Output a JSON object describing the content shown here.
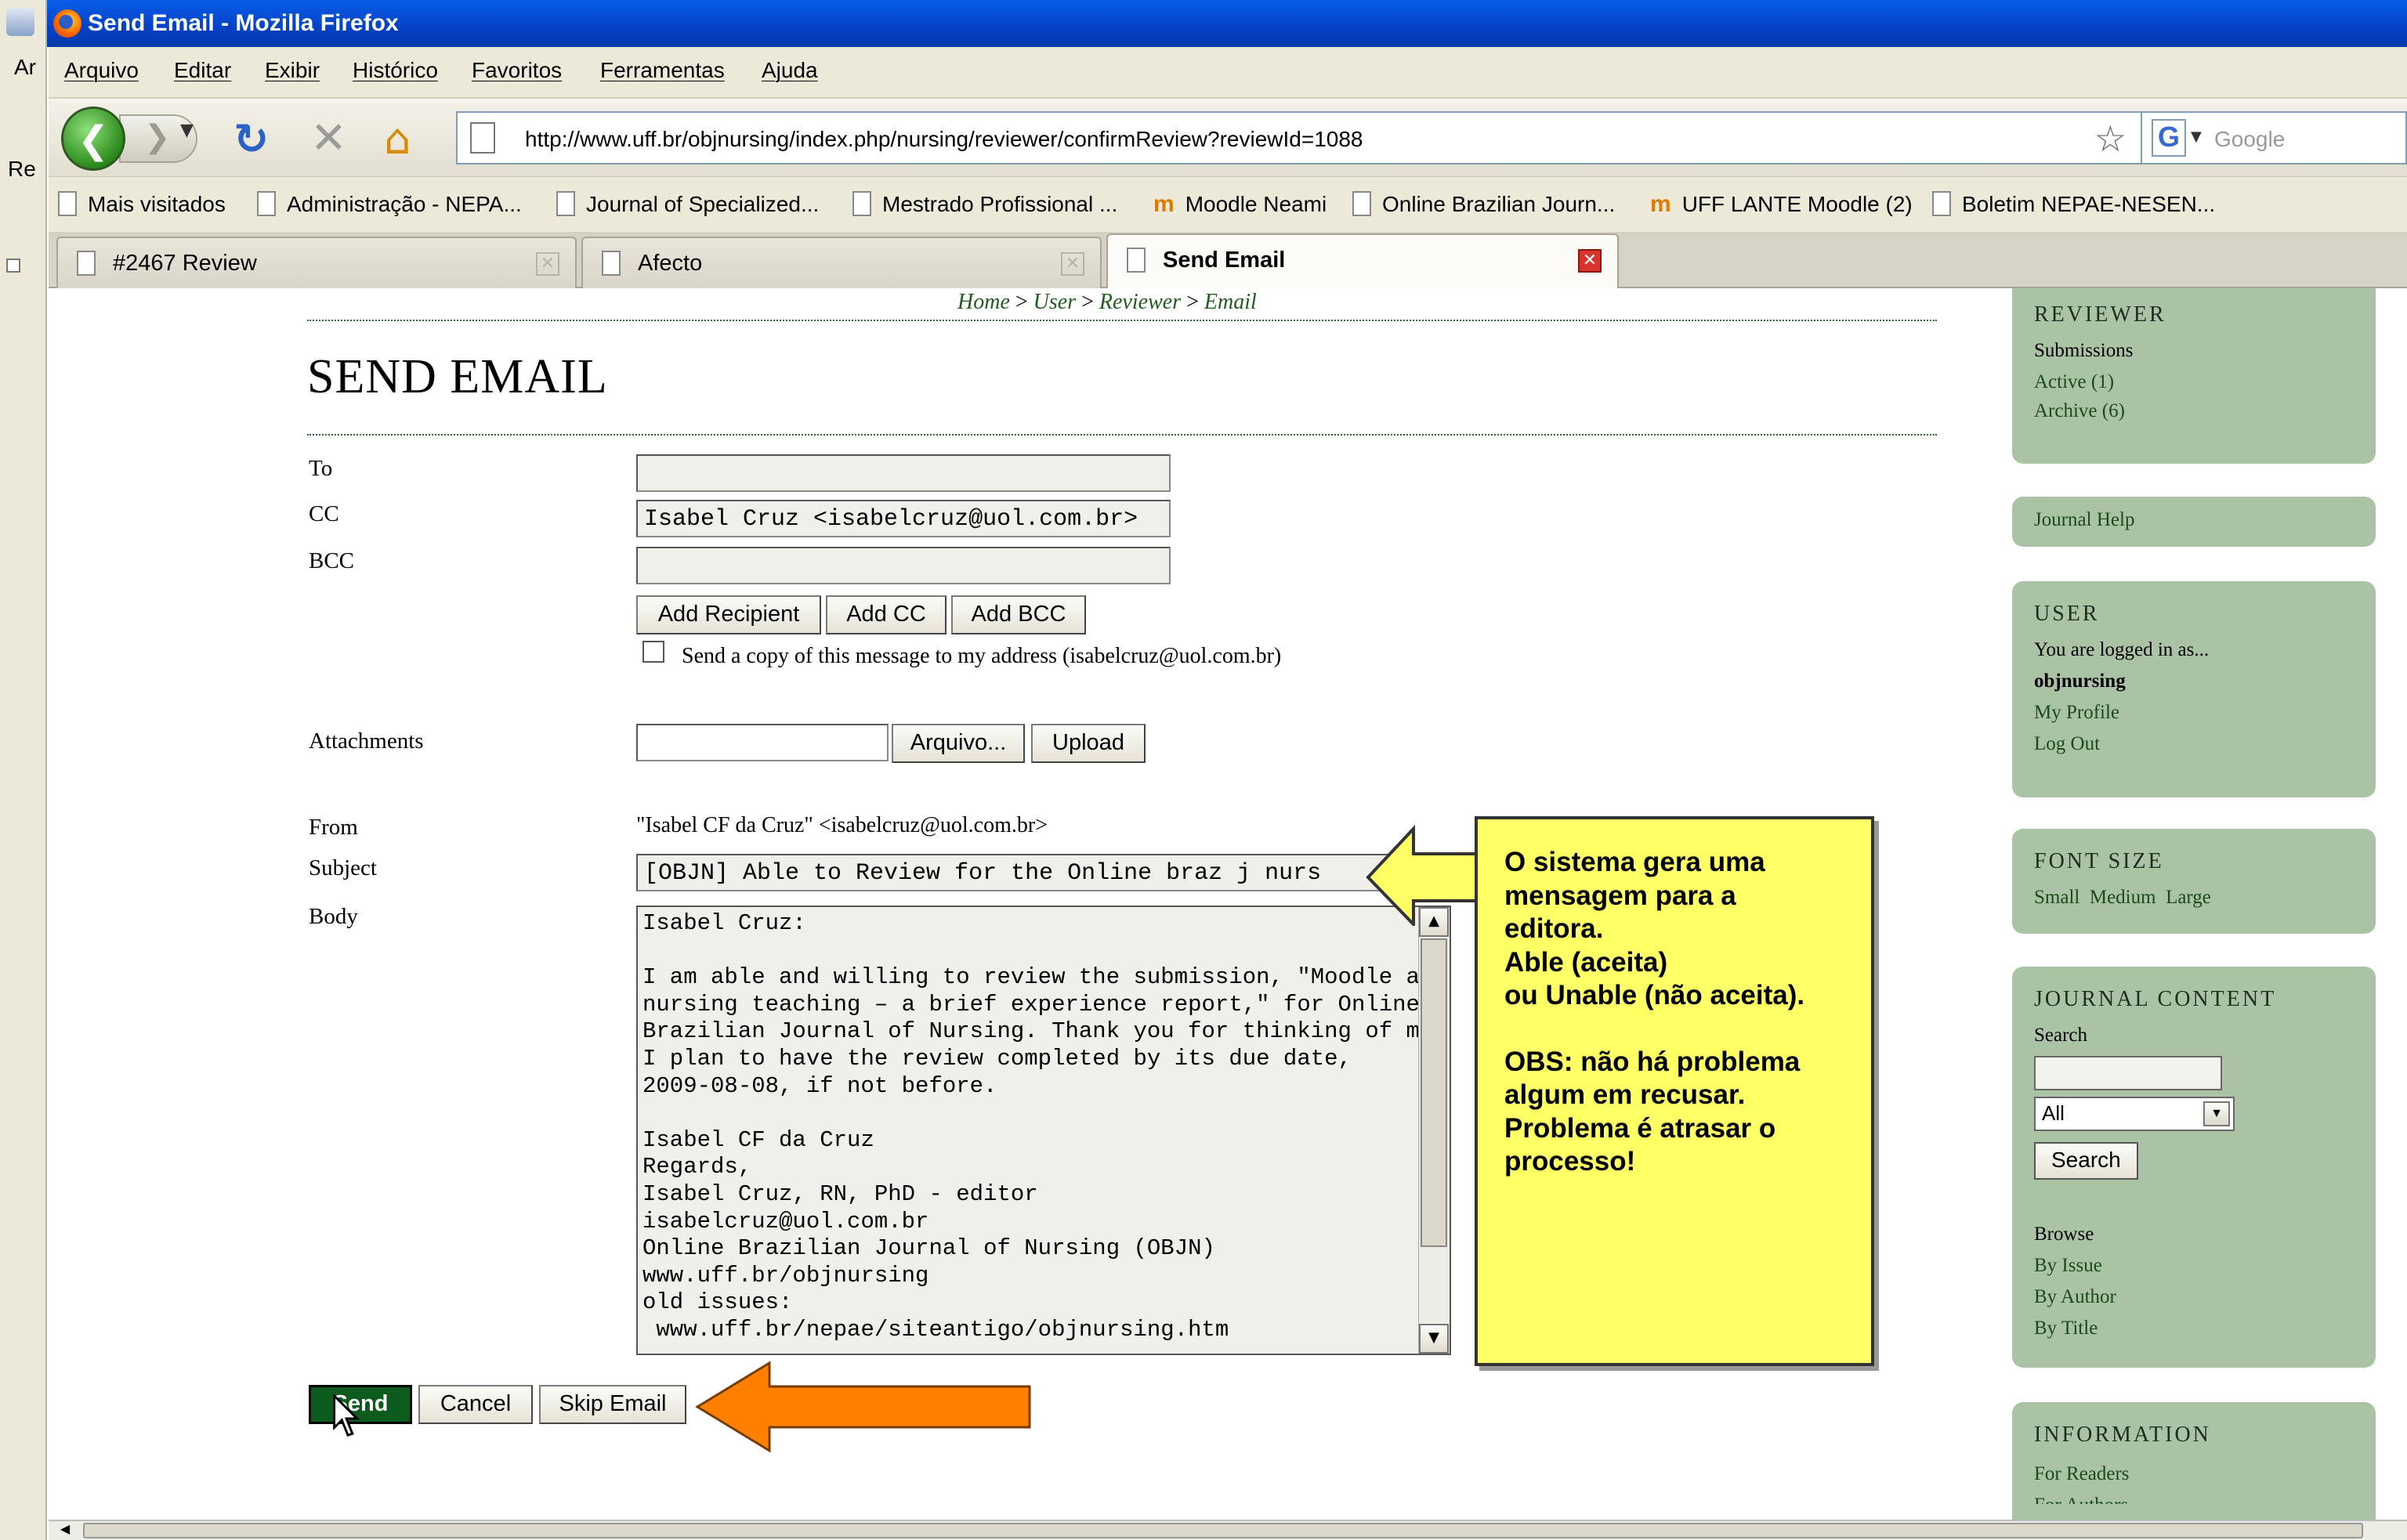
{
  "window": {
    "title": "Send Email - Mozilla Firefox"
  },
  "leftstrip": {
    "frag1": "Ar",
    "frag2": "Re"
  },
  "menu": [
    "Arquivo",
    "Editar",
    "Exibir",
    "Histórico",
    "Favoritos",
    "Ferramentas",
    "Ajuda"
  ],
  "nav": {
    "url": "http://www.uff.br/objnursing/index.php/nursing/reviewer/confirmReview?reviewId=1088",
    "search_placeholder": "Google",
    "search_engine_letter": "G"
  },
  "bookmarks": [
    {
      "label": "Mais visitados",
      "icon": "page-icon"
    },
    {
      "label": "Administração - NEPA...",
      "icon": "page-icon"
    },
    {
      "label": "Journal of Specialized...",
      "icon": "page-icon"
    },
    {
      "label": "Mestrado Profissional ...",
      "icon": "page-icon"
    },
    {
      "label": "Moodle Neami",
      "icon": "moodle-icon"
    },
    {
      "label": "Online Brazilian Journ...",
      "icon": "page-icon"
    },
    {
      "label": "UFF LANTE Moodle (2)",
      "icon": "moodle-icon"
    },
    {
      "label": "Boletim NEPAE-NESEN...",
      "icon": "page-icon"
    }
  ],
  "tabs": [
    {
      "label": "#2467 Review",
      "active": false
    },
    {
      "label": "Afecto",
      "active": false
    },
    {
      "label": "Send Email",
      "active": true
    }
  ],
  "breadcrumb": {
    "home": "Home",
    "user": "User",
    "reviewer": "Reviewer",
    "email": "Email",
    "sep": ">"
  },
  "page": {
    "title": "SEND EMAIL"
  },
  "form": {
    "to_label": "To",
    "cc_label": "CC",
    "bcc_label": "BCC",
    "to_value": "",
    "cc_value": "Isabel Cruz <isabelcruz@uol.com.br>",
    "bcc_value": "",
    "add_recipient": "Add Recipient",
    "add_cc": "Add CC",
    "add_bcc": "Add BCC",
    "copy_label": "Send a copy of this message to my address (isabelcruz@uol.com.br)",
    "attachments_label": "Attachments",
    "browse_button": "Arquivo...",
    "upload_button": "Upload",
    "from_label": "From",
    "from_value": "\"Isabel CF da Cruz\" <isabelcruz@uol.com.br>",
    "subject_label": "Subject",
    "subject_value": "[OBJN] Able to Review for the Online braz j nurs",
    "body_label": "Body",
    "body_value": "Isabel Cruz:\n\nI am able and willing to review the submission, \"Moodle and\nnursing teaching – a brief experience report,\" for Online\nBrazilian Journal of Nursing. Thank you for thinking of me, and\nI plan to have the review completed by its due date,\n2009-08-08, if not before.\n\nIsabel CF da Cruz\nRegards,\nIsabel Cruz, RN, PhD - editor\nisabelcruz@uol.com.br\nOnline Brazilian Journal of Nursing (OBJN)\nwww.uff.br/objnursing\nold issues:\n www.uff.br/nepae/siteantigo/objnursing.htm",
    "send_button": "Send",
    "cancel_button": "Cancel",
    "skip_button": "Skip Email"
  },
  "callout": {
    "lines": [
      "O sistema gera uma",
      "mensagem para a",
      "editora.",
      "Able (aceita)",
      "ou Unable (não aceita).",
      "",
      "OBS: não há problema",
      "algum em recusar.",
      "Problema é atrasar o",
      "processo!"
    ],
    "color": "#ffff66",
    "arrow_color_yellow": "#ffff66",
    "arrow_color_orange": "#ff8000"
  },
  "sidebar": {
    "reviewer_head": "REVIEWER",
    "submissions": "Submissions",
    "active": "Active (1)",
    "archive": "Archive (6)",
    "journal_help": "Journal Help",
    "user_head": "USER",
    "logged_in": "You are logged in as...",
    "username": "objnursing",
    "my_profile": "My Profile",
    "log_out": "Log Out",
    "font_head": "FONT SIZE",
    "small": "Small",
    "medium": "Medium",
    "large": "Large",
    "content_head": "JOURNAL CONTENT",
    "search_label": "Search",
    "search_select": "All",
    "search_button": "Search",
    "browse": "Browse",
    "by_issue": "By Issue",
    "by_author": "By Author",
    "by_title": "By Title",
    "info_head": "INFORMATION",
    "for_readers": "For Readers",
    "for_authors": "For Authors",
    "color": "#a9c3a4"
  }
}
